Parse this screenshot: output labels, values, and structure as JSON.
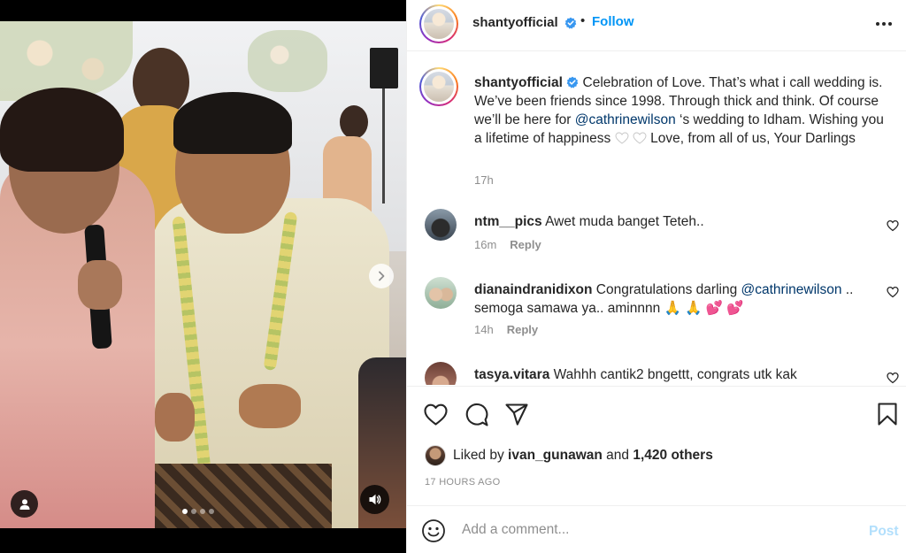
{
  "colors": {
    "accent": "#0095f6",
    "mention": "#00376b",
    "muted": "#8e8e8e",
    "post_disabled": "#b2dffc",
    "verified": "#3897f0"
  },
  "media": {
    "carousel_count": 4,
    "active_index": 0,
    "icons": {
      "next": "chevron-right-icon",
      "tags": "user-icon",
      "audio": "speaker-icon"
    }
  },
  "header": {
    "username": "shantyofficial",
    "separator": "•",
    "follow_label": "Follow",
    "more_icon": "more-horizontal-icon"
  },
  "caption": {
    "username": "shantyofficial",
    "text_before_mention": "Celebration of Love. That’s what i call wedding is. We’ve been friends since 1998. Through thick and think. Of course we’ll be here for ",
    "mention": "@cathrinewilson",
    "text_after_mention": " ‘s wedding to Idham. Wishing you a lifetime of happiness ",
    "text_end": " Love, from all of us, Your Darlings",
    "time": "17h"
  },
  "comments": [
    {
      "username": "ntm__pics",
      "text": "Awet muda banget Teteh..",
      "time": "16m",
      "reply": "Reply"
    },
    {
      "username": "dianaindranidixon",
      "text_before_mention": "Congratulations darling ",
      "mention": "@cathrinewilson",
      "text_after_mention": " .. semoga samawa ya.. aminnnn ",
      "emojis": "🙏 🙏 💕 💕",
      "time": "14h",
      "reply": "Reply"
    },
    {
      "username": "tasya.vitara",
      "text": "Wahhh cantik2 bngettt, congrats utk kak"
    }
  ],
  "actions": {
    "icons": [
      "heart-icon",
      "comment-icon",
      "share-icon",
      "bookmark-icon"
    ],
    "liked_prefix": "Liked by",
    "liked_user": "ivan_gunawan",
    "liked_and": "and",
    "liked_others": "1,420 others",
    "post_time": "17 HOURS AGO"
  },
  "add_comment": {
    "placeholder": "Add a comment...",
    "post_label": "Post"
  }
}
